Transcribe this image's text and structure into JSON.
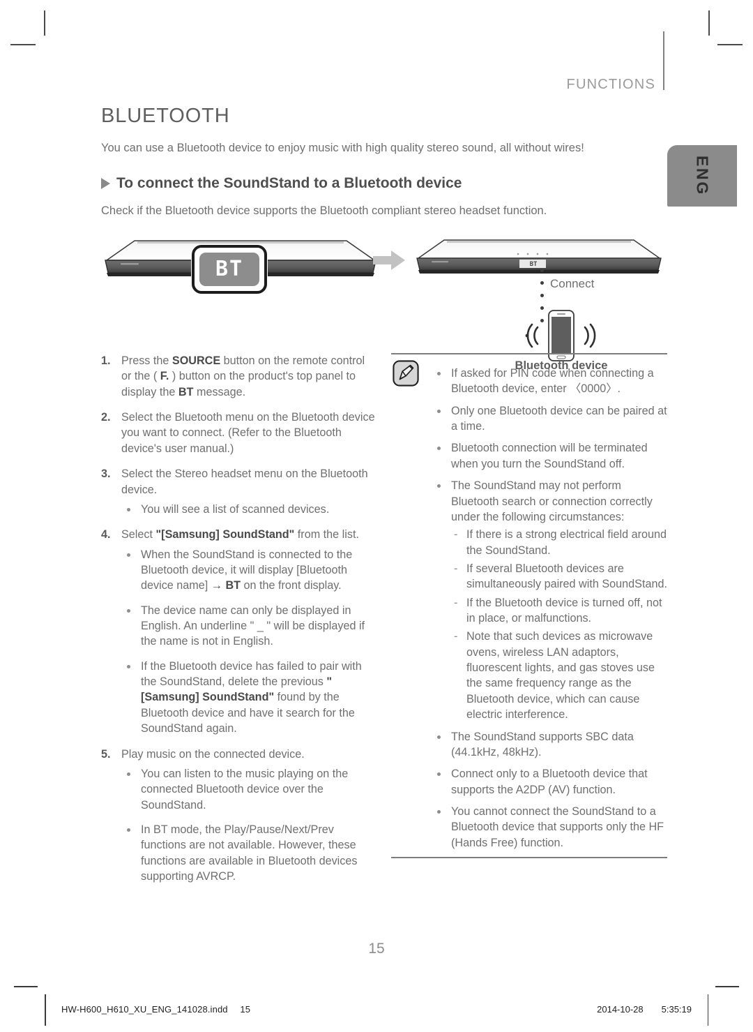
{
  "header": {
    "section_label": "FUNCTIONS",
    "language_tab": "ENG"
  },
  "page": {
    "title": "BLUETOOTH",
    "lead": "You can use a Bluetooth device to enjoy music with high quality stereo sound, all without wires!",
    "subtitle": "To connect the SoundStand to a Bluetooth device",
    "sublead": "Check if the Bluetooth device supports the Bluetooth compliant stereo headset function.",
    "page_number": "15"
  },
  "figure": {
    "display_text_left": "BT",
    "display_text_right": "BT",
    "connect_label": "Connect",
    "device_label": "Bluetooth device"
  },
  "steps": [
    {
      "num": "1.",
      "html": "Press the <b>SOURCE</b> button on the remote control or the ( <b>F.</b> ) button on the product's top panel to display the <b>BT</b> message."
    },
    {
      "num": "2.",
      "html": "Select the Bluetooth menu on the Bluetooth device you want to connect. (Refer to the Bluetooth device's user manual.)"
    },
    {
      "num": "3.",
      "html": "Select the Stereo headset menu on the Bluetooth device."
    },
    {
      "num": "4.",
      "html": "Select <b>\"[Samsung] SoundStand\"</b> from the list."
    },
    {
      "num": "5.",
      "html": "Play music on the connected device."
    }
  ],
  "step3_bullets": [
    {
      "html": "You will see a list of scanned devices."
    }
  ],
  "step4_bullets": [
    {
      "html": "When the SoundStand is connected to the Bluetooth device, it will display [Bluetooth device name] <b>&rarr; BT</b> on the front display."
    },
    {
      "html": "The device name can only be displayed in English. An underline \" _ \" will be displayed if the name is not in English."
    },
    {
      "html": "If the Bluetooth device has failed to pair with the SoundStand, delete the previous <b>\"[Samsung] SoundStand\"</b> found by the Bluetooth device and have it search for the SoundStand again."
    }
  ],
  "step5_bullets": [
    {
      "html": "You can listen to the music playing on the connected Bluetooth device over the SoundStand."
    },
    {
      "html": "In BT mode, the Play/Pause/Next/Prev functions are not available. However, these functions are available in Bluetooth devices supporting AVRCP."
    }
  ],
  "note": {
    "icon_name": "note-pencil-icon",
    "bullets": [
      {
        "html": "If asked for PIN code when connecting a Bluetooth device, enter &#9001;0000&#9002;."
      },
      {
        "html": "Only one Bluetooth device can be paired at a time."
      },
      {
        "html": "Bluetooth connection will be terminated when you turn the SoundStand off."
      },
      {
        "html": "The SoundStand may not perform Bluetooth search or connection correctly under the following circumstances:",
        "dashes": [
          {
            "html": "If there is a strong electrical field around the SoundStand."
          },
          {
            "html": "If several Bluetooth devices are simultaneously paired with SoundStand."
          },
          {
            "html": "If the Bluetooth device is turned off, not in place, or malfunctions."
          },
          {
            "html": "Note that such devices as microwave ovens, wireless LAN adaptors, fluorescent lights, and gas stoves use the same frequency range as the Bluetooth device, which can cause electric interference."
          }
        ]
      },
      {
        "html": "The SoundStand supports SBC data (44.1kHz, 48kHz)."
      },
      {
        "html": "Connect only to a Bluetooth device that supports the A2DP (AV) function."
      },
      {
        "html": "You cannot connect the SoundStand to a Bluetooth device that supports only the HF (Hands Free) function."
      }
    ]
  },
  "footer": {
    "file_name": "HW-H600_H610_XU_ENG_141028.indd",
    "file_page": "15",
    "date": "2014-10-28",
    "time": "5:35:19"
  },
  "colors": {
    "body_text": "#6f6f6f",
    "heading": "#5a5a5a",
    "rule": "#7d7d7d",
    "tab_bg": "#8b8b8b"
  }
}
